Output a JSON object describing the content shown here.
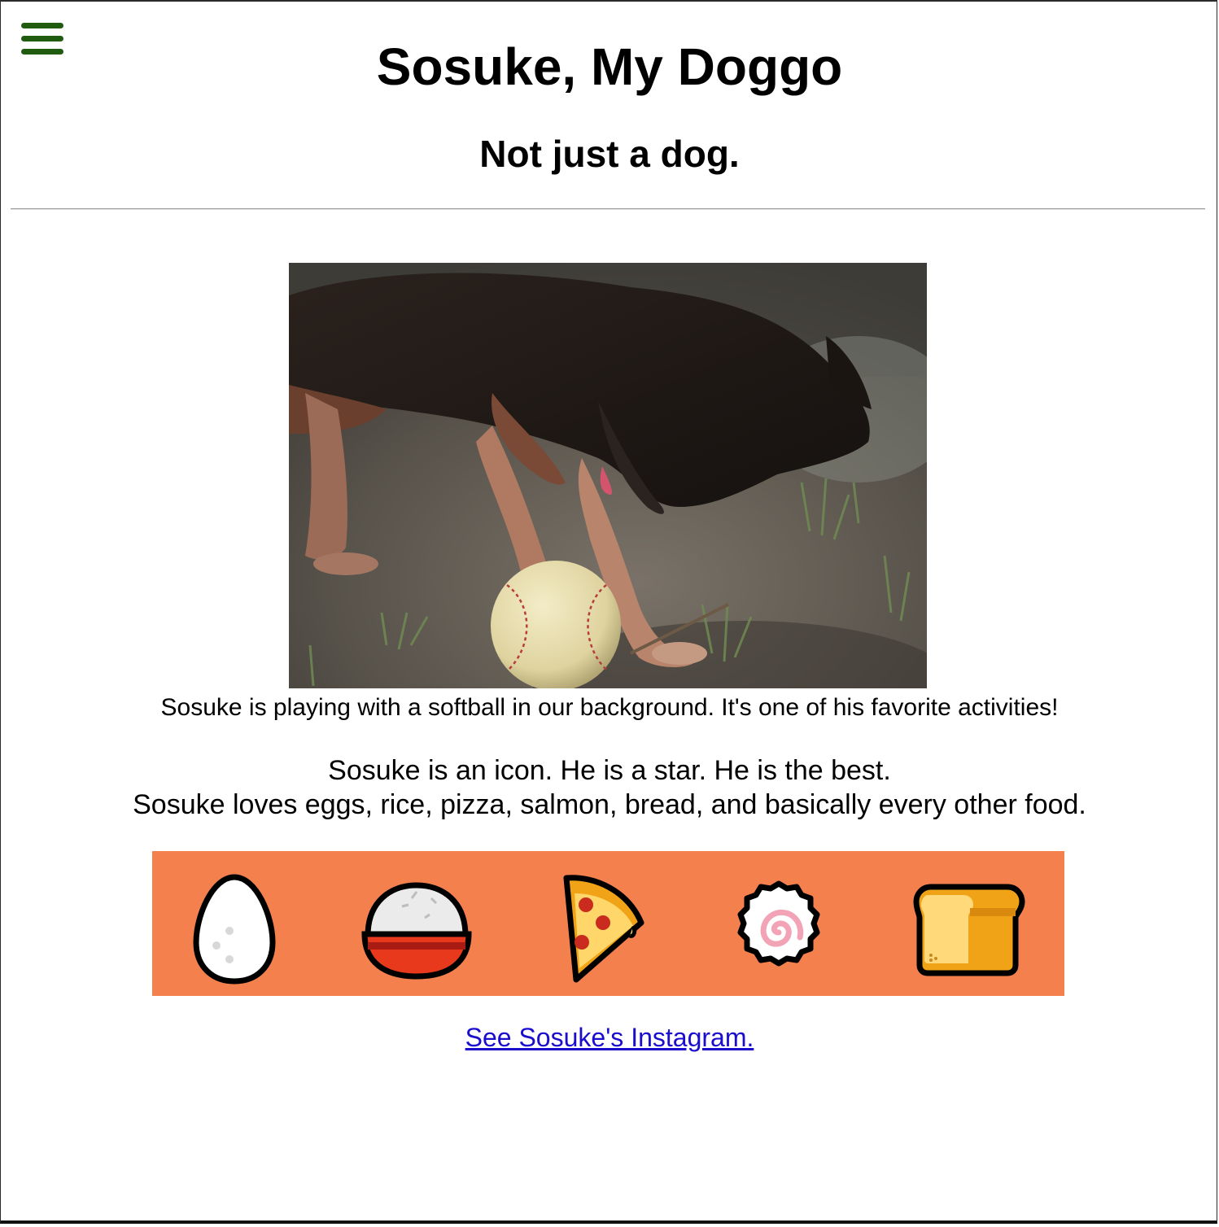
{
  "header": {
    "title": "Sosuke, My Doggo",
    "subtitle": "Not just a dog."
  },
  "menu": {
    "icon": "hamburger-menu-icon",
    "color": "#1f5c0f"
  },
  "photo": {
    "subject": "dog pawing a softball on dirt and grass"
  },
  "caption": "Sosuke is playing with a softball in our background. It's one of his favorite activities!",
  "bio": {
    "line1": "Sosuke is an icon. He is a star. He is the best.",
    "line2": "Sosuke loves eggs, rice, pizza, salmon, bread, and basically every other food."
  },
  "foods": {
    "background": "#f3804d",
    "icons": [
      "egg-icon",
      "rice-bowl-icon",
      "pizza-slice-icon",
      "fish-cake-icon",
      "bread-loaf-icon"
    ]
  },
  "instagram": {
    "link_text": "See Sosuke's Instagram."
  },
  "colors": {
    "link": "#1a0dcc",
    "divider": "#9a9a9a"
  }
}
